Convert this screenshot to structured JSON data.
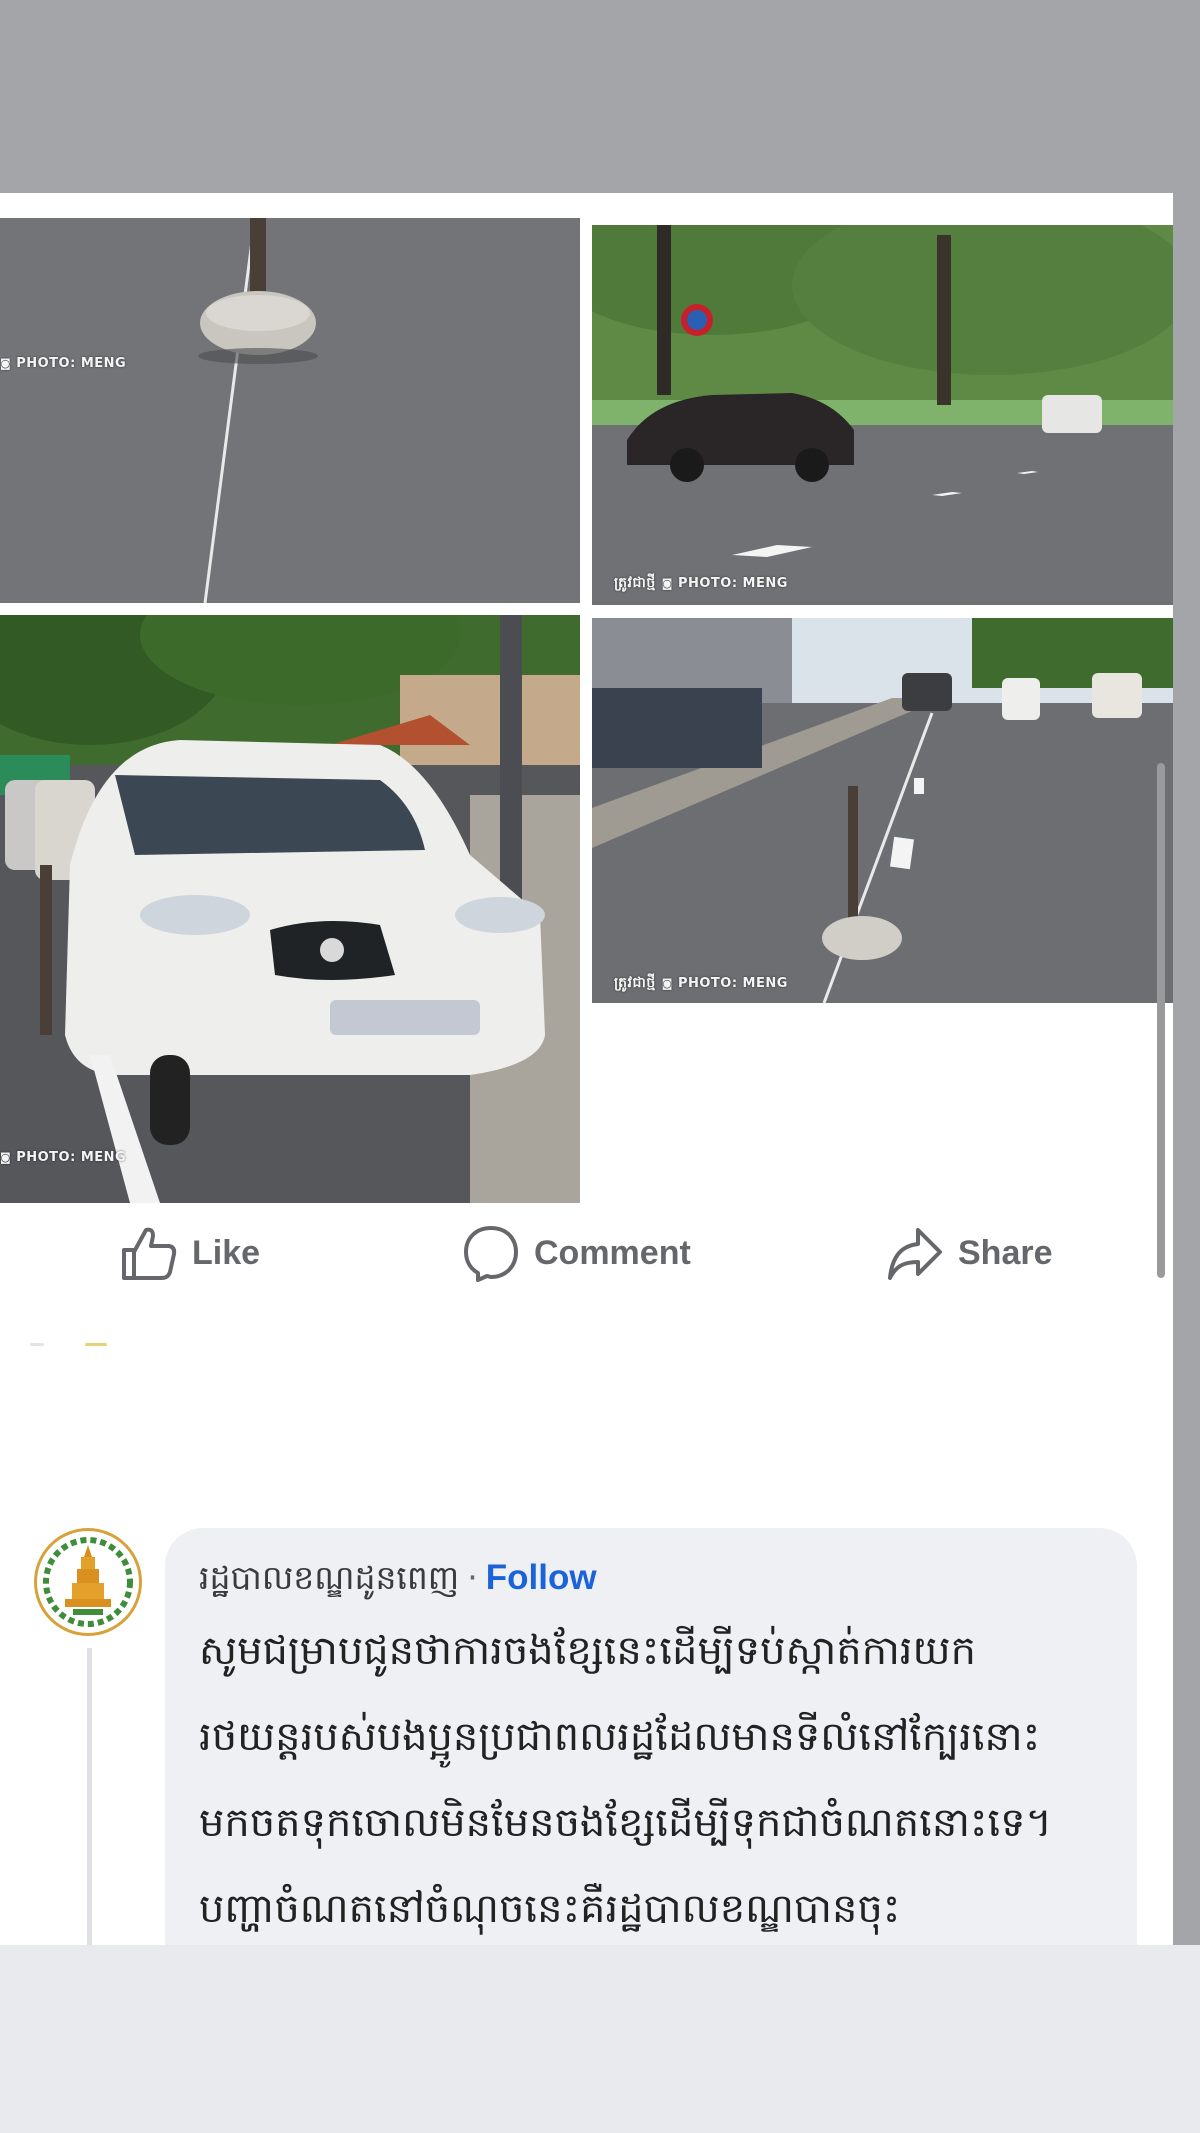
{
  "watermarks": {
    "photo_meng": "PHOTO: MENG",
    "km_brand": "ត្រូវជាថ្មី"
  },
  "actions": {
    "like_label": "Like",
    "comment_label": "Comment",
    "share_label": "Share"
  },
  "comment": {
    "author": "រដ្ឋបាលខណ្ឌដូនពេញ",
    "separator": "·",
    "follow_label": "Follow",
    "body": "សូមជម្រាបជូនថាការចងខ្សែនេះដើម្បីទប់ស្កាត់ការយក\nរថយន្តរបស់បងប្អូនប្រជាពលរដ្ឋដែលមានទីលំនៅក្បែរនោះ\nមកចតទុកចោលមិនមែនចងខ្សែដើម្បីទុកជាចំណតនោះទេ។\nបញ្ហាចំណតនៅចំណុចនេះគឺរដ្ឋបាលខណ្ឌបានចុះ\nផ្សព្វផ្សាយជារៀងរាល់ថ្ងៃតែបងប្អូនគាត់មិនទាន់បានចូលរួម\nទាំងអស់គ្នានោះឡើយ។"
  },
  "icons": {
    "like": "thumbs-up-icon",
    "comment": "speech-bubble-icon",
    "share": "share-arrow-icon",
    "avatar": "district-emblem-icon"
  },
  "colors": {
    "follow": "#1b63d9",
    "action_text": "#65676b",
    "bubble_bg": "#eff0f3",
    "dim_bg": "#a4a5a8"
  }
}
